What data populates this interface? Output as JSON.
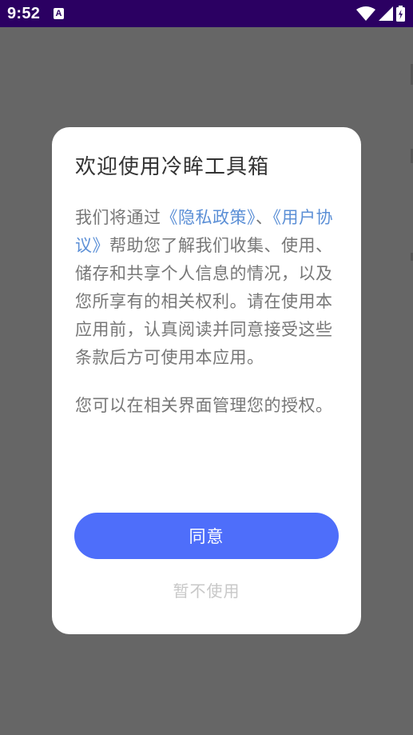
{
  "status_bar": {
    "time": "9:52",
    "notification_icon": "A",
    "icons": [
      "wifi-icon",
      "signal-icon",
      "battery-charging-icon"
    ]
  },
  "colors": {
    "status_bar_bg": "#2b0062",
    "overlay": "#666666",
    "dialog_bg": "#ffffff",
    "primary_button": "#4e6efa",
    "link": "#5b8fd6",
    "body_text": "#777777",
    "title_text": "#333333",
    "secondary_button_text": "#c8c8c8"
  },
  "dialog": {
    "title": "欢迎使用冷眸工具箱",
    "body": {
      "prefix": "我们将通过",
      "privacy_link": "《隐私政策》",
      "separator": "、",
      "agreement_link": "《用户协议》",
      "suffix": "帮助您了解我们收集、使用、储存和共享个人信息的情况，以及您所享有的相关权利。请在使用本应用前，认真阅读并同意接受这些条款后方可使用本应用。"
    },
    "note": "您可以在相关界面管理您的授权。",
    "agree_label": "同意",
    "decline_label": "暂不使用"
  }
}
